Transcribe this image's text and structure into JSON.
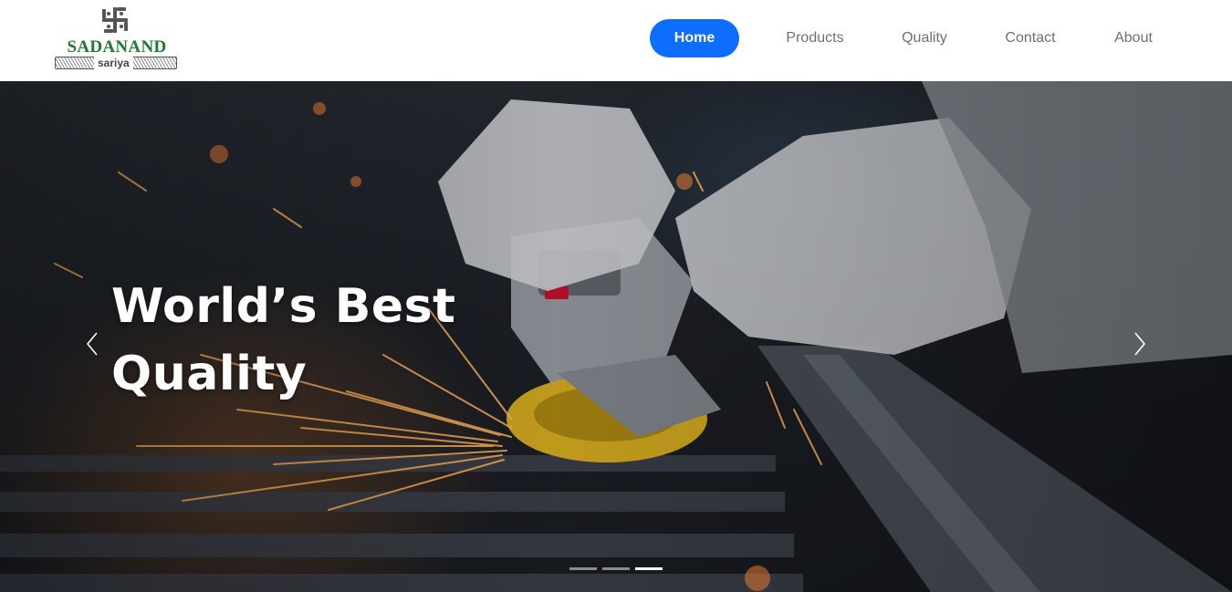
{
  "brand": {
    "name": "SADANAND",
    "tagline": "sariya",
    "logo_icon": "swastik-logo-icon",
    "name_color": "#1f7a2e"
  },
  "nav": {
    "items": [
      {
        "label": "Home",
        "active": true
      },
      {
        "label": "Products",
        "active": false
      },
      {
        "label": "Quality",
        "active": false
      },
      {
        "label": "Contact",
        "active": false
      },
      {
        "label": "About",
        "active": false
      }
    ],
    "active_color": "#0d6efd"
  },
  "hero": {
    "title_line1": "World’s Best",
    "title_line2": "Quality",
    "prev_icon": "chevron-left-icon",
    "next_icon": "chevron-right-icon",
    "slide_count": 3,
    "active_slide": 3
  }
}
